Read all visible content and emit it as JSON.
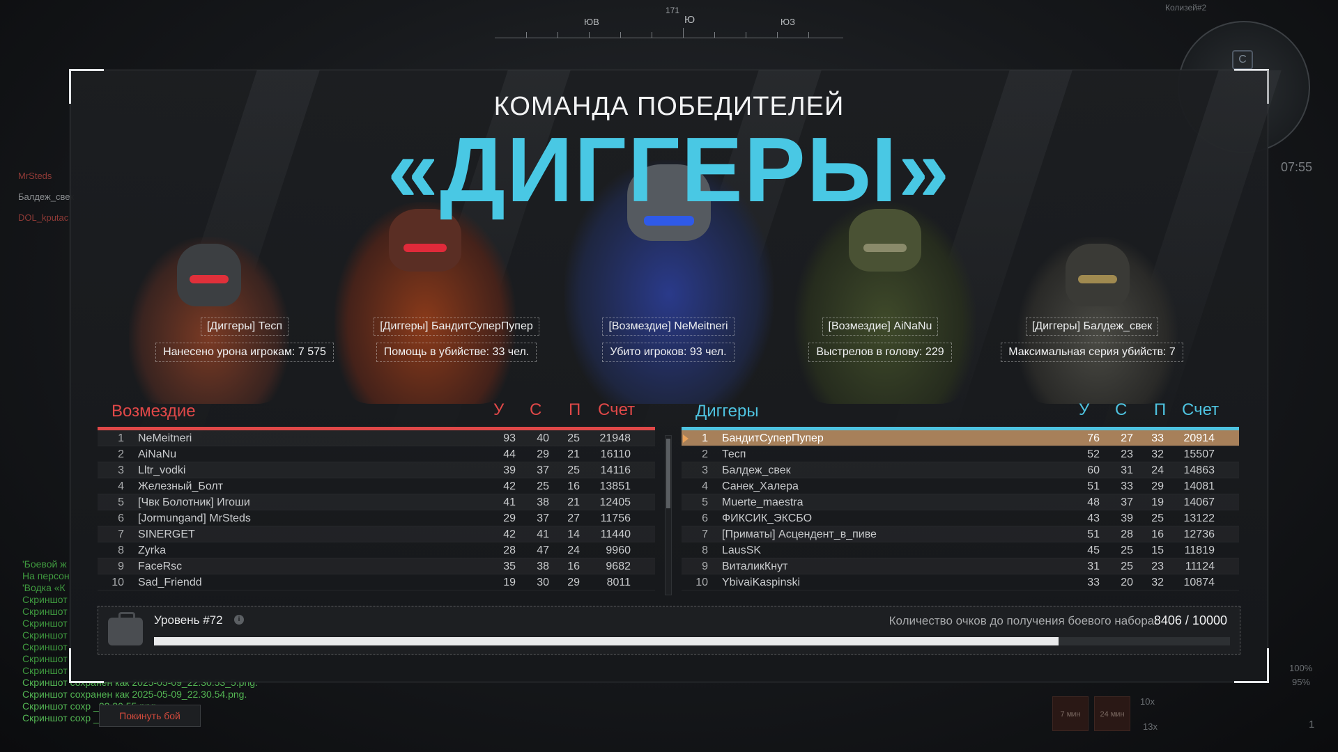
{
  "compass": {
    "bearing": "171",
    "left": "ЮВ",
    "center": "Ю",
    "right": "ЮЗ"
  },
  "map_label": "Колизей#2",
  "minimap_icon": "C",
  "timer": "07:55",
  "side_players": [
    "MrSteds",
    "Балдеж_свек",
    "DOL_kputac"
  ],
  "chat": [
    "'Боевой ж",
    "На персон",
    "'Водка «К",
    "Скриншот",
    "Скриншот",
    "Скриншот",
    "Скриншот",
    "Скриншот",
    "Скриншот",
    "Скриншот",
    "Скриншот сохранен как 2025-05-09_22.30.53_5.png.",
    "Скриншот сохранен как 2025-05-09_22.30.54.png.",
    "Скриншот сохр       _22.30.55.png.",
    "Скриншот сохр       _22.30.56.png."
  ],
  "hud": {
    "t1": "7 мин",
    "t2": "24 мин",
    "multA": "10x",
    "multB": "13x",
    "pct1": "100%",
    "pct2": "95%",
    "count": "1"
  },
  "header": {
    "subtitle": "КОМАНДА ПОБЕДИТЕЛЕЙ",
    "team": "«ДИГГЕРЫ»"
  },
  "highlights": [
    {
      "name": "[Диггеры] Тесп",
      "stat": "Нанесено урона игрокам: 7 575",
      "color": "#c93a2a"
    },
    {
      "name": "[Диггеры] БандитСуперПупер",
      "stat": "Помощь в убийстве: 33 чел.",
      "color": "#b0452a"
    },
    {
      "name": "[Возмездие] NeMeitneri",
      "stat": "Убито игроков: 93 чел.",
      "color": "#2a46c8"
    },
    {
      "name": "[Возмездие] AiNaNu",
      "stat": "Выстрелов в голову: 229",
      "color": "#4a5a30"
    },
    {
      "name": "[Диггеры] Балдеж_свек",
      "stat": "Максимальная серия убийств: 7",
      "color": "#4a4a44"
    }
  ],
  "columns": {
    "k": "У",
    "d": "С",
    "a": "П",
    "score": "Счет"
  },
  "teams": [
    {
      "name": "Возмездие",
      "color": "#e04848",
      "rows": [
        {
          "rank": "1",
          "name": "NeMeitneri",
          "k": "93",
          "d": "40",
          "a": "25",
          "score": "21948"
        },
        {
          "rank": "2",
          "name": "AiNaNu",
          "k": "44",
          "d": "29",
          "a": "21",
          "score": "16110"
        },
        {
          "rank": "3",
          "name": "Lltr_vodki",
          "k": "39",
          "d": "37",
          "a": "25",
          "score": "14116"
        },
        {
          "rank": "4",
          "name": "Железный_Болт",
          "k": "42",
          "d": "25",
          "a": "16",
          "score": "13851"
        },
        {
          "rank": "5",
          "name": "[Чвк Болотник] Игоши",
          "k": "41",
          "d": "38",
          "a": "21",
          "score": "12405"
        },
        {
          "rank": "6",
          "name": "[Jormungand] MrSteds",
          "k": "29",
          "d": "37",
          "a": "27",
          "score": "11756"
        },
        {
          "rank": "7",
          "name": "SINERGET",
          "k": "42",
          "d": "41",
          "a": "14",
          "score": "11440"
        },
        {
          "rank": "8",
          "name": "Zyrka",
          "k": "28",
          "d": "47",
          "a": "24",
          "score": "9960"
        },
        {
          "rank": "9",
          "name": "FaceRsc",
          "k": "35",
          "d": "38",
          "a": "16",
          "score": "9682"
        },
        {
          "rank": "10",
          "name": "Sad_Friendd",
          "k": "19",
          "d": "30",
          "a": "29",
          "score": "8011"
        }
      ]
    },
    {
      "name": "Диггеры",
      "color": "#4ec3e0",
      "rows": [
        {
          "rank": "1",
          "name": "БандитСуперПупер",
          "k": "76",
          "d": "27",
          "a": "33",
          "score": "20914",
          "me": true
        },
        {
          "rank": "2",
          "name": "Тесп",
          "k": "52",
          "d": "23",
          "a": "32",
          "score": "15507"
        },
        {
          "rank": "3",
          "name": "Балдеж_свек",
          "k": "60",
          "d": "31",
          "a": "24",
          "score": "14863"
        },
        {
          "rank": "4",
          "name": "Санек_Халера",
          "k": "51",
          "d": "33",
          "a": "29",
          "score": "14081"
        },
        {
          "rank": "5",
          "name": "Muerte_maestra",
          "k": "48",
          "d": "37",
          "a": "19",
          "score": "14067"
        },
        {
          "rank": "6",
          "name": "ФИКСИК_ЭКСБО",
          "k": "43",
          "d": "39",
          "a": "25",
          "score": "13122"
        },
        {
          "rank": "7",
          "name": "[Приматы] Асцендент_в_пиве",
          "k": "51",
          "d": "28",
          "a": "16",
          "score": "12736"
        },
        {
          "rank": "8",
          "name": "LausSK",
          "k": "45",
          "d": "25",
          "a": "15",
          "score": "11819"
        },
        {
          "rank": "9",
          "name": "ВиталикКнут",
          "k": "31",
          "d": "25",
          "a": "23",
          "score": "11124"
        },
        {
          "rank": "10",
          "name": "YbivaiKaspinski",
          "k": "33",
          "d": "20",
          "a": "32",
          "score": "10874"
        }
      ]
    }
  ],
  "level": {
    "label": "Уровень #72",
    "points_label": "Количество очков до получения боевого набора:",
    "points": "8406 / 10000",
    "progress": 0.8406
  },
  "leave_label": "Покинуть бой"
}
